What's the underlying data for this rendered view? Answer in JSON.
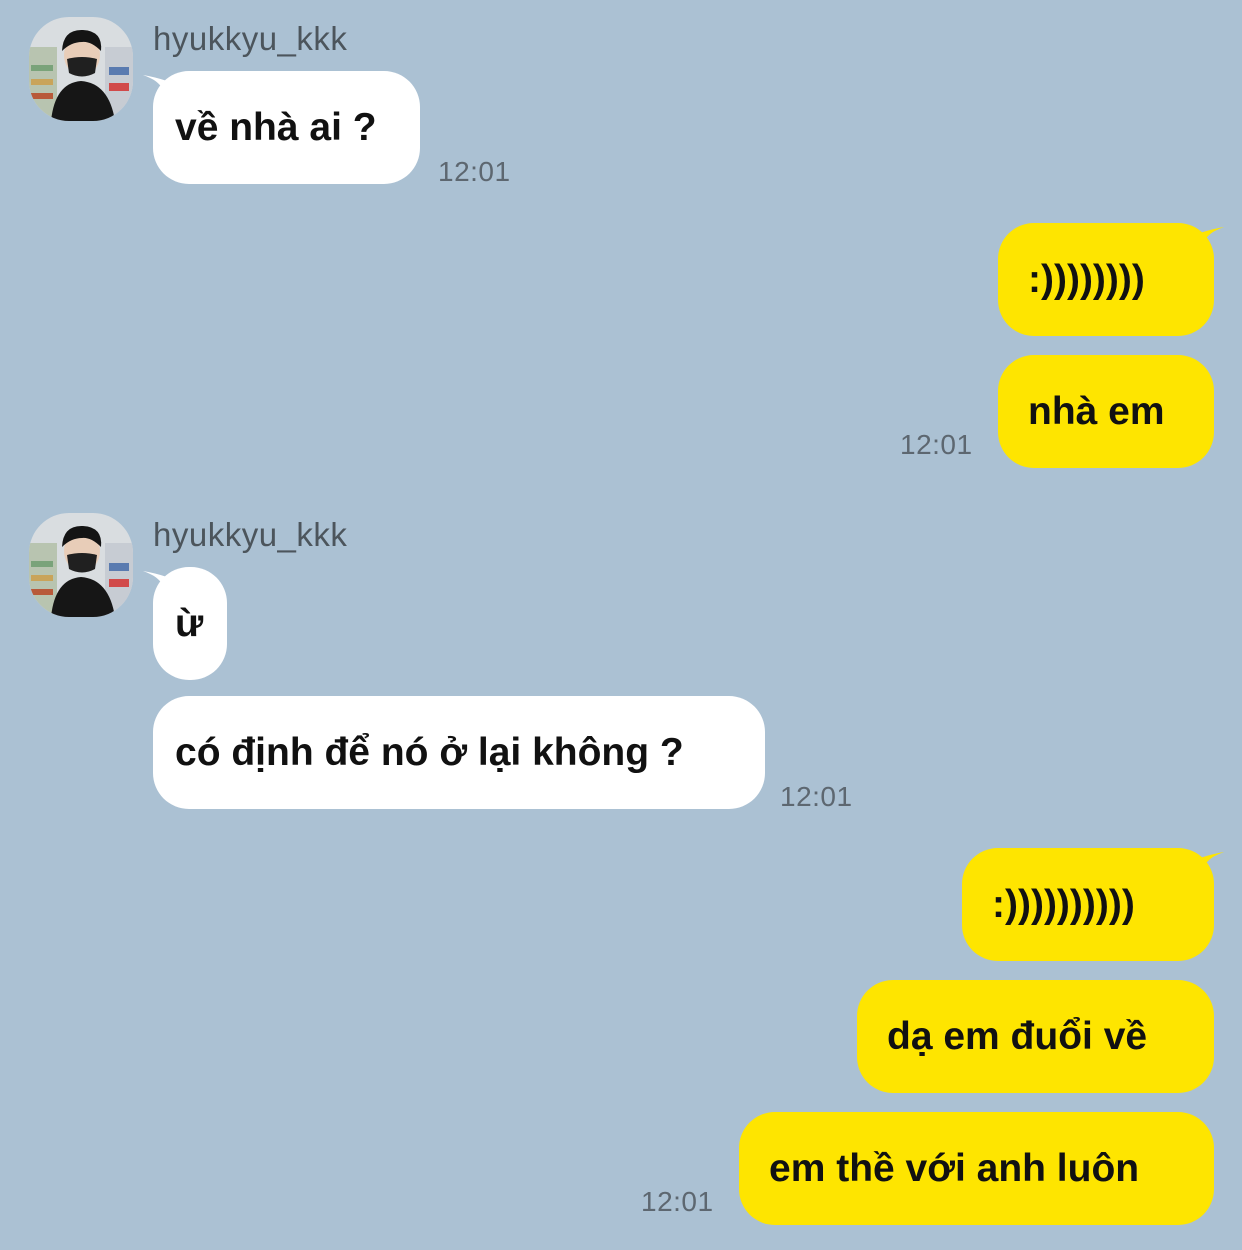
{
  "chat": {
    "colors": {
      "background": "#abc1d3",
      "incoming_bubble": "#ffffff",
      "outgoing_bubble": "#fee500"
    },
    "groups": [
      {
        "direction": "incoming",
        "sender": "hyukkyu_kkk",
        "messages": [
          "về nhà ai ?"
        ],
        "time": "12:01"
      },
      {
        "direction": "outgoing",
        "messages": [
          ":))))))))",
          "nhà em"
        ],
        "time": "12:01"
      },
      {
        "direction": "incoming",
        "sender": "hyukkyu_kkk",
        "messages": [
          "ừ",
          "có định để nó ở lại không ?"
        ],
        "time": "12:01"
      },
      {
        "direction": "outgoing",
        "messages": [
          ":))))))))))",
          "dạ em đuổi về",
          "em thề với anh luôn"
        ],
        "time": "12:01"
      }
    ]
  }
}
